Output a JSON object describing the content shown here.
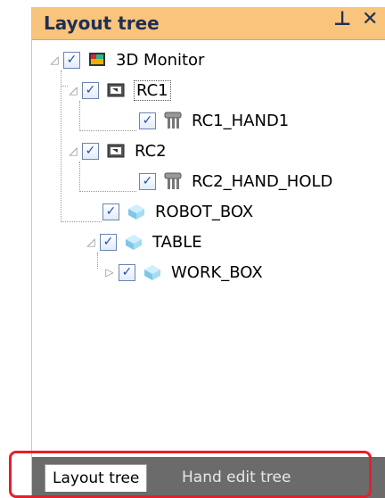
{
  "window": {
    "title": "Layout tree",
    "pin_icon": "⊥",
    "close_icon": "✕"
  },
  "tree": [
    {
      "id": "monitor",
      "label": "3D Monitor",
      "icon": "monitor-icon",
      "expanded": true,
      "checked": true
    },
    {
      "id": "rc1",
      "label": "RC1",
      "icon": "controller-icon",
      "expanded": true,
      "checked": true,
      "selected": true
    },
    {
      "id": "rc1_hand1",
      "label": "RC1_HAND1",
      "icon": "hand-icon",
      "checked": true
    },
    {
      "id": "rc2",
      "label": "RC2",
      "icon": "controller-icon",
      "expanded": true,
      "checked": true
    },
    {
      "id": "rc2_hand_hold",
      "label": "RC2_HAND_HOLD",
      "icon": "hand-icon",
      "checked": true
    },
    {
      "id": "robot_box",
      "label": "ROBOT_BOX",
      "icon": "box-icon",
      "checked": true
    },
    {
      "id": "table",
      "label": "TABLE",
      "icon": "box-icon",
      "expanded": true,
      "checked": true
    },
    {
      "id": "work_box",
      "label": "WORK_BOX",
      "icon": "box-icon",
      "expanded": false,
      "checked": true
    }
  ],
  "tabs": [
    {
      "label": "Layout tree",
      "active": true
    },
    {
      "label": "Hand edit tree",
      "active": false
    }
  ],
  "colors": {
    "caption": "#f9c47b",
    "tab_bar": "#6b6b6b",
    "highlight": "#e3202b"
  }
}
